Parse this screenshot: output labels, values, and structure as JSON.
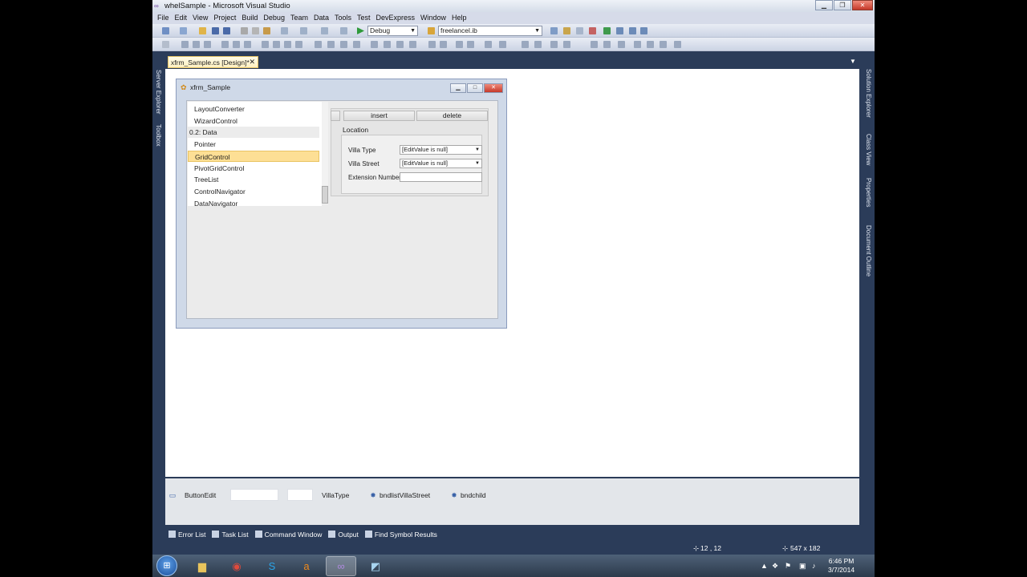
{
  "window": {
    "title": "whelSample - Microsoft Visual Studio"
  },
  "menu": [
    "File",
    "Edit",
    "View",
    "Project",
    "Build",
    "Debug",
    "Team",
    "Data",
    "Tools",
    "Test",
    "DevExpress",
    "Window",
    "Help"
  ],
  "toolbar": {
    "config": "Debug",
    "target": "freelancel.ib"
  },
  "doc_tab": {
    "label": "xfrm_Sample.cs [Design]*",
    "close": "✕"
  },
  "left_rail": {
    "server_explorer": "Server Explorer",
    "toolbox": "Toolbox"
  },
  "right_rail": {
    "solution_explorer": "Solution Explorer",
    "class_view": "Class View",
    "properties": "Properties",
    "document_outline": "Document Outline"
  },
  "form": {
    "title": "xfrm_Sample",
    "list": {
      "items": [
        {
          "label": "LayoutConverter",
          "kind": "item"
        },
        {
          "label": "WizardControl",
          "kind": "item"
        },
        {
          "label": "0.2: Data",
          "kind": "group"
        },
        {
          "label": "Pointer",
          "kind": "item"
        },
        {
          "label": "GridControl",
          "kind": "selected"
        },
        {
          "label": "PivotGridControl",
          "kind": "item"
        },
        {
          "label": "TreeList",
          "kind": "item"
        },
        {
          "label": "ControlNavigator",
          "kind": "item"
        },
        {
          "label": "DataNavigator",
          "kind": "item"
        }
      ]
    },
    "layout": {
      "insert_label": "insert",
      "delete_label": "delete",
      "group_title": "Location",
      "villa_type_label": "Villa Type",
      "villa_type_value": "[EditValue is null]",
      "villa_street_label": "Villa Street",
      "villa_street_value": "[EditValue is null]",
      "extension_label": "Extension Number"
    }
  },
  "tray": {
    "button_edit": "ButtonEdit",
    "villa_type": "VillaType",
    "bndlist": "bndlistVillaStreet",
    "bndchild": "bndchild"
  },
  "output_tabs": [
    "Error List",
    "Task List",
    "Command Window",
    "Output",
    "Find Symbol Results"
  ],
  "status": {
    "position": "12 , 12",
    "size": "547 x 182"
  },
  "clock": {
    "time": "6:46 PM",
    "date": "3/7/2014"
  }
}
